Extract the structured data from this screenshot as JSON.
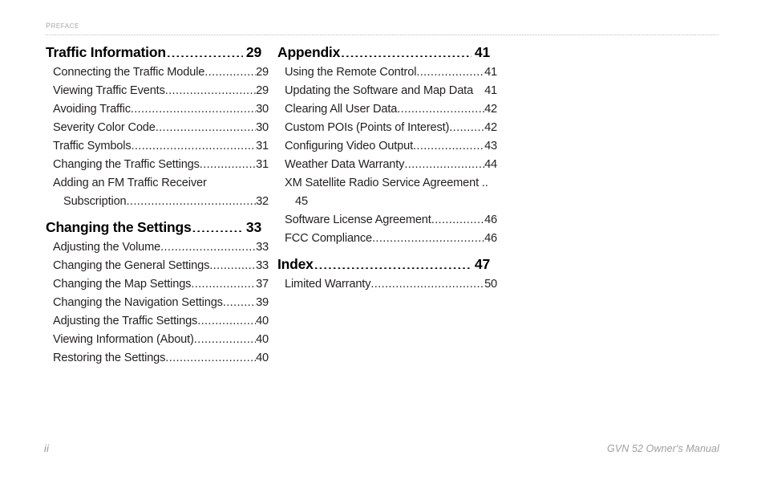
{
  "header": {
    "running_head": "Preface"
  },
  "footer": {
    "page_number": "ii",
    "manual_title": "GVN 52 Owner's Manual"
  },
  "toc": {
    "left_column": [
      {
        "level": 1,
        "label": "Traffic Information",
        "page": "29",
        "children": [
          {
            "level": 2,
            "label": "Connecting the Traffic Module",
            "page": "29"
          },
          {
            "level": 2,
            "label": "Viewing Traffic Events",
            "page": "29"
          },
          {
            "level": 2,
            "label": "Avoiding Traffic",
            "page": "30"
          },
          {
            "level": 2,
            "label": "Severity Color Code",
            "page": "30"
          },
          {
            "level": 2,
            "label": "Traffic Symbols",
            "page": "31"
          },
          {
            "level": 2,
            "label": "Changing the Traffic Settings",
            "page": "31"
          },
          {
            "level": 2,
            "label": "Adding an FM Traffic Receiver",
            "label2": "Subscription",
            "page": "32",
            "wrapped": true
          }
        ]
      },
      {
        "level": 1,
        "label": "Changing the Settings",
        "page": "33",
        "children": [
          {
            "level": 2,
            "label": "Adjusting the Volume",
            "page": "33"
          },
          {
            "level": 2,
            "label": "Changing the General Settings",
            "page": "33"
          },
          {
            "level": 2,
            "label": "Changing the Map Settings",
            "page": "37"
          },
          {
            "level": 2,
            "label": "Changing the Navigation Settings",
            "page": "39"
          },
          {
            "level": 2,
            "label": "Adjusting the Traffic Settings",
            "page": "40"
          },
          {
            "level": 2,
            "label": "Viewing Information (About)",
            "page": "40"
          },
          {
            "level": 2,
            "label": "Restoring the Settings",
            "page": "40"
          }
        ]
      }
    ],
    "right_column": [
      {
        "level": 1,
        "label": "Appendix",
        "page": "41",
        "children": [
          {
            "level": 2,
            "label": "Using the Remote Control",
            "page": "41"
          },
          {
            "level": 2,
            "label": "Updating the Software and Map Data",
            "page": "41",
            "no_dots": true
          },
          {
            "level": 2,
            "label": "Clearing All User Data",
            "page": "42"
          },
          {
            "level": 2,
            "label": "Custom POIs (Points of Interest)",
            "page": "42"
          },
          {
            "level": 2,
            "label": "Configuring Video Output",
            "page": "43"
          },
          {
            "level": 2,
            "label": "Weather Data Warranty",
            "page": "44"
          },
          {
            "level": 2,
            "label": "XM Satellite Radio Service Agreement ..",
            "label2": "45",
            "page": "45",
            "wrapped": true,
            "page_on_second_line": true
          },
          {
            "level": 2,
            "label": "Software License Agreement",
            "page": "46"
          },
          {
            "level": 2,
            "label": "FCC Compliance",
            "page": "46"
          }
        ]
      },
      {
        "level": 1,
        "label": "Index",
        "page": "47",
        "children": [
          {
            "level": 2,
            "label": "Limited Warranty",
            "page": "50"
          }
        ]
      }
    ]
  }
}
